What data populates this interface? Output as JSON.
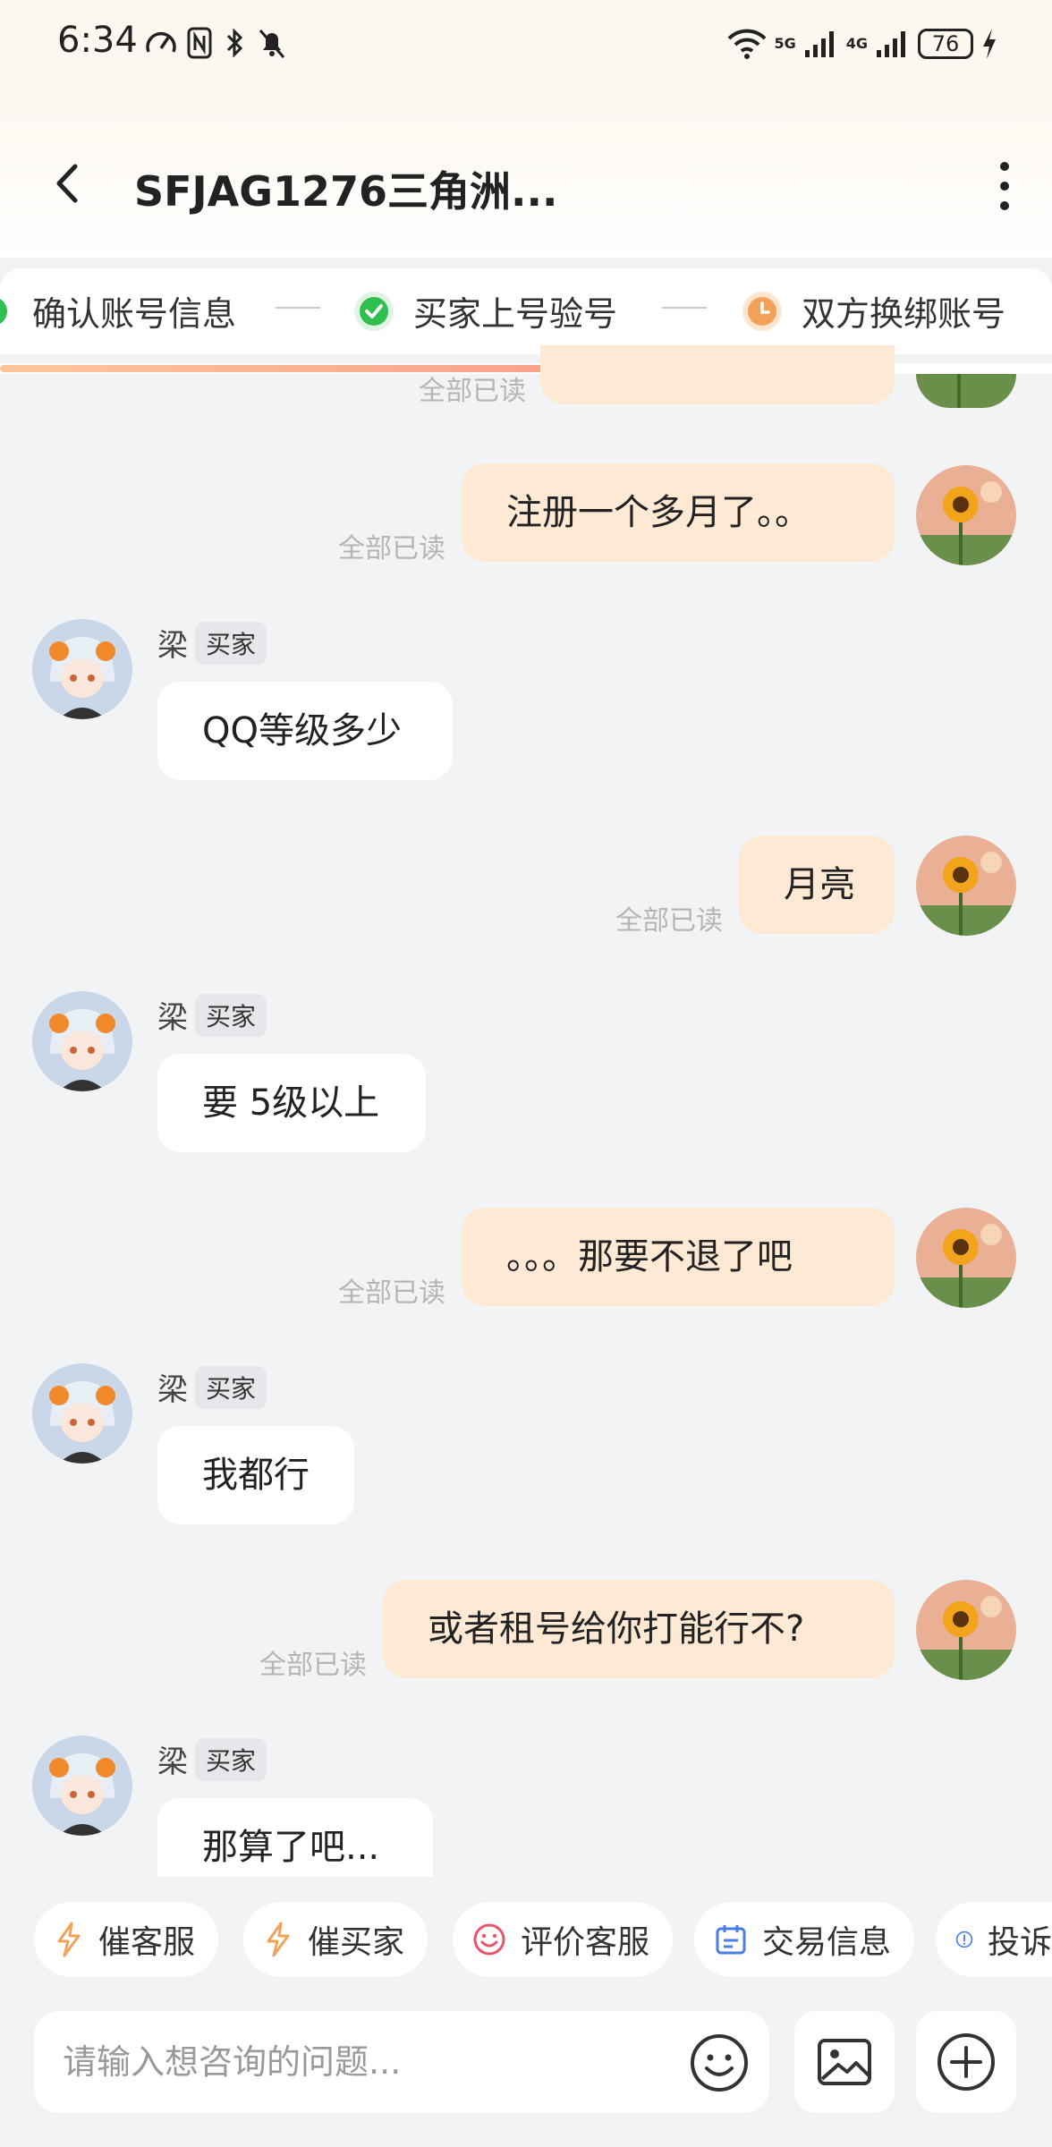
{
  "status_bar": {
    "time": "6:34",
    "battery": "76",
    "net1": "5G",
    "net2": "4G"
  },
  "header": {
    "title": "SFJAG1276三角洲..."
  },
  "steps": [
    {
      "label": "确认账号信息",
      "state": "done"
    },
    {
      "label": "买家上号验号",
      "state": "done"
    },
    {
      "label": "双方换绑账号",
      "state": "current"
    }
  ],
  "progress": 0.83,
  "messages": [
    {
      "side": "me",
      "text": "",
      "read": "全部已读"
    },
    {
      "side": "me",
      "text": "注册一个多月了。。",
      "read": "全部已读"
    },
    {
      "side": "them",
      "name": "梁",
      "tag": "买家",
      "text": "QQ等级多少"
    },
    {
      "side": "me",
      "text": "月亮",
      "read": "全部已读"
    },
    {
      "side": "them",
      "name": "梁",
      "tag": "买家",
      "text": "要 5级以上"
    },
    {
      "side": "me",
      "text": "。。。那要不退了吧",
      "read": "全部已读"
    },
    {
      "side": "them",
      "name": "梁",
      "tag": "买家",
      "text": "我都行"
    },
    {
      "side": "me",
      "text": "或者租号给你打能行不?",
      "read": "全部已读"
    },
    {
      "side": "them",
      "name": "梁",
      "tag": "买家",
      "text": "那算了吧..."
    }
  ],
  "quick_actions": [
    {
      "label": "催客服",
      "icon": "lightning-icon"
    },
    {
      "label": "催买家",
      "icon": "lightning-icon"
    },
    {
      "label": "评价客服",
      "icon": "smile-icon"
    },
    {
      "label": "交易信息",
      "icon": "calendar-icon"
    },
    {
      "label": "投诉",
      "icon": "alert-icon"
    }
  ],
  "input": {
    "placeholder": "请输入想咨询的问题..."
  },
  "colors": {
    "accent": "#f4a259",
    "bubble_me": "#fde9d4",
    "check_green": "#2fbf4f"
  }
}
